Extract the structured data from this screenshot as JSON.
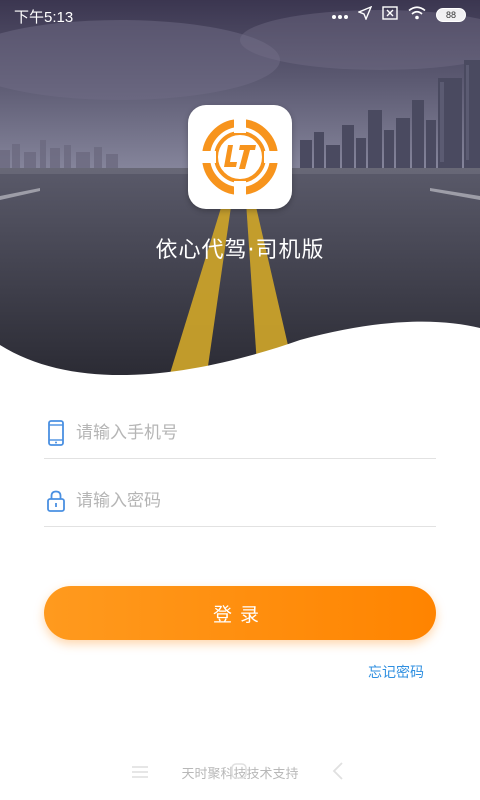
{
  "status_bar": {
    "time": "下午5:13",
    "battery": "88",
    "icons": [
      "more-dots-icon",
      "location-arrow-icon",
      "sim-none-icon",
      "wifi-icon",
      "battery-icon"
    ]
  },
  "app": {
    "name": "依心代驾·司机版",
    "logo_icon": "app-logo-icon"
  },
  "form": {
    "phone_placeholder": "请输入手机号",
    "password_placeholder": "请输入密码",
    "login_label": "登录",
    "forgot_label": "忘记密码"
  },
  "footer": {
    "text": "天时聚科技技术支持"
  },
  "colors": {
    "accent": "#ff8c0a",
    "link": "#2f8fe0",
    "icon_blue": "#4a90e2"
  }
}
